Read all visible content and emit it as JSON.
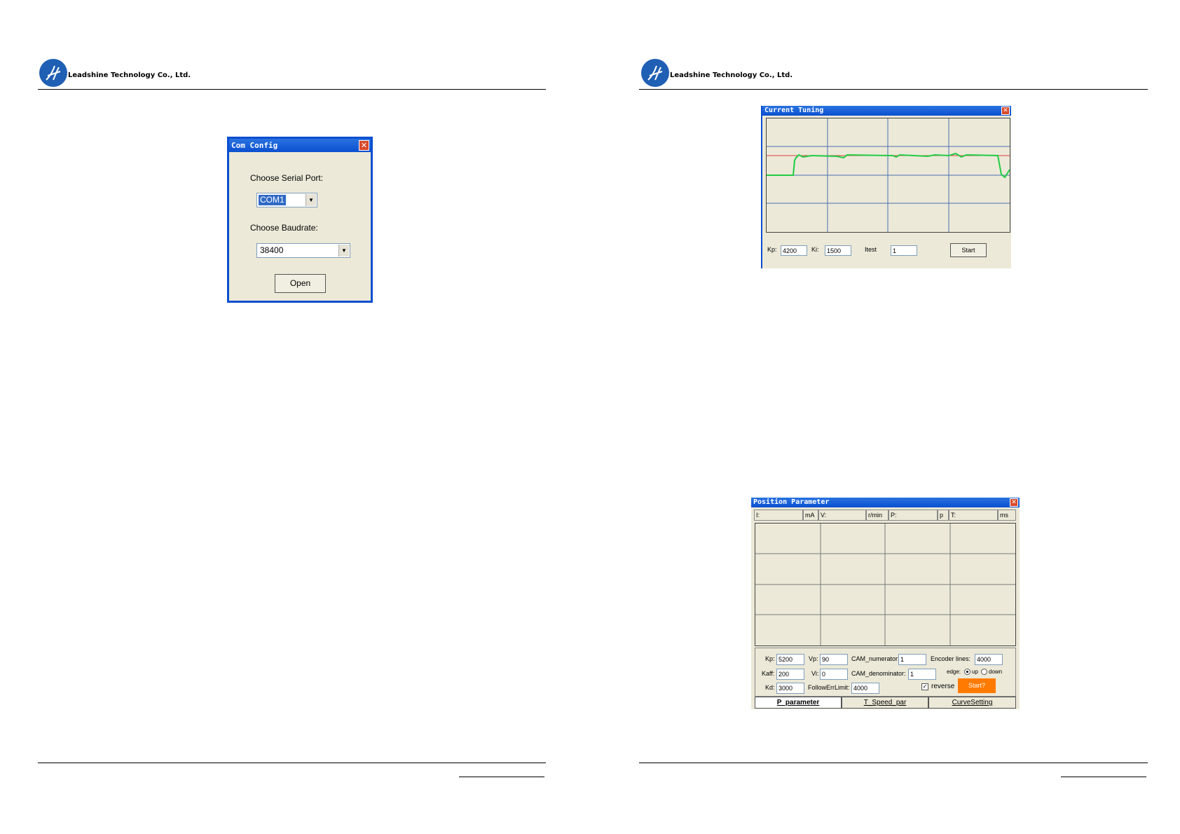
{
  "header": {
    "company": "Leadshine Technology Co., Ltd."
  },
  "com_config": {
    "title": "Com Config",
    "serial_port_label": "Choose Serial Port:",
    "serial_port_value": "COM1",
    "baudrate_label": "Choose Baudrate:",
    "baudrate_value": "38400",
    "open_button": "Open"
  },
  "current_tuning": {
    "title": "Current Tuning",
    "kp_label": "Kp:",
    "kp_value": "4200",
    "ki_label": "Ki:",
    "ki_value": "1500",
    "itest_label": "Itest",
    "itest_value": "1",
    "start_button": "Start"
  },
  "position_parameter": {
    "title": "Position Parameter",
    "status": {
      "i_label": "I:",
      "i_unit": "mA",
      "v_label": "V:",
      "v_unit": "r/min",
      "p_label": "P:",
      "p_unit": "p",
      "t_label": "T:",
      "t_unit": "ms"
    },
    "kp_label": "Kp:",
    "kp_value": "5200",
    "vp_label": "Vp:",
    "vp_value": "90",
    "cam_num_label": "CAM_numerator:",
    "cam_num_value": "1",
    "encoder_label": "Encoder lines:",
    "encoder_value": "4000",
    "kaff_label": "Kaff:",
    "kaff_value": "200",
    "vi_label": "Vi:",
    "vi_value": "0",
    "cam_den_label": "CAM_denominator:",
    "cam_den_value": "1",
    "edge_label": "edge:",
    "edge_up": "up",
    "edge_down": "down",
    "kd_label": "Kd:",
    "kd_value": "3000",
    "follow_label": "FollowErrLimit:",
    "follow_value": "4000",
    "reverse_label": "reverse",
    "start_button": "Start?",
    "tabs": [
      "P_parameter",
      "T_Speed_par",
      "CurveSetting"
    ]
  },
  "colors": {
    "titlebar": "#0a4fd0",
    "window_bg": "#ece9d8",
    "trace_green": "#22cc44",
    "reference_red": "#e04040",
    "start_orange": "#ff7a00"
  }
}
